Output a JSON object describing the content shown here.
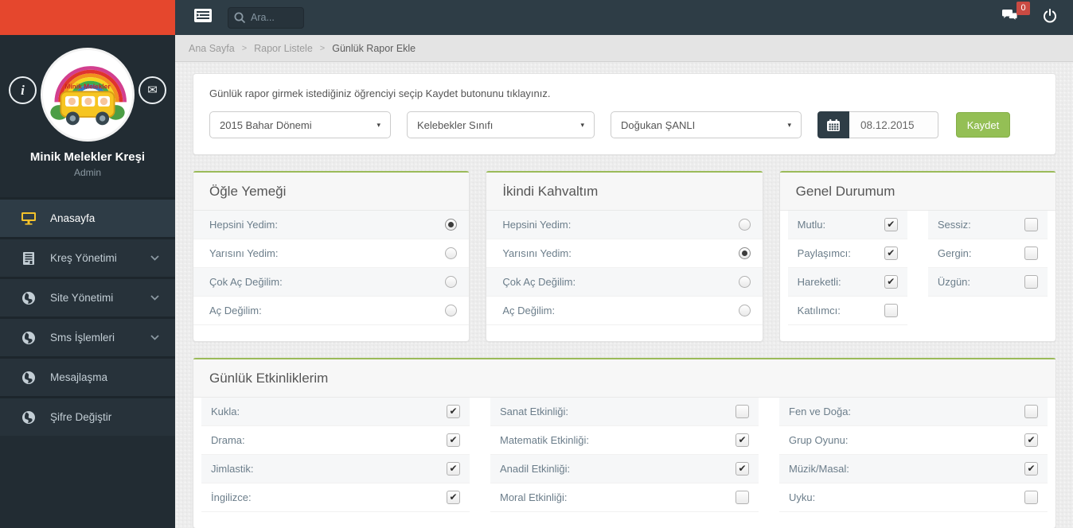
{
  "navbar": {
    "search_placeholder": "Ara...",
    "chat_badge": "0"
  },
  "sidebar": {
    "school_name": "Minik Melekler Kreşi",
    "role": "Admin",
    "avatar_text": "Minik Melekler",
    "menu": [
      {
        "label": "Anasayfa",
        "icon": "monitor-icon",
        "active": true,
        "chevron": false
      },
      {
        "label": "Kreş Yönetimi",
        "icon": "building-icon",
        "active": false,
        "chevron": true
      },
      {
        "label": "Site Yönetimi",
        "icon": "globe-icon",
        "active": false,
        "chevron": true
      },
      {
        "label": "Sms İşlemleri",
        "icon": "globe-icon",
        "active": false,
        "chevron": true
      },
      {
        "label": "Mesajlaşma",
        "icon": "globe-icon",
        "active": false,
        "chevron": false
      },
      {
        "label": "Şifre Değiştir",
        "icon": "globe-icon",
        "active": false,
        "chevron": false
      }
    ]
  },
  "breadcrumb": [
    "Ana Sayfa",
    "Rapor Listele",
    "Günlük Rapor Ekle"
  ],
  "form": {
    "instruction": "Günlük rapor girmek istediğiniz öğrenciyi seçip Kaydet butonunu tıklayınız.",
    "term_select": "2015 Bahar Dönemi",
    "class_select": "Kelebekler Sınıfı",
    "student_select": "Doğukan ŞANLI",
    "date_value": "08.12.2015",
    "save_label": "Kaydet"
  },
  "lunch": {
    "title": "Öğle Yemeği",
    "options": [
      {
        "label": "Hepsini Yedim:",
        "checked": true
      },
      {
        "label": "Yarısını Yedim:",
        "checked": false
      },
      {
        "label": "Çok Aç Değilim:",
        "checked": false
      },
      {
        "label": "Aç Değilim:",
        "checked": false
      }
    ]
  },
  "snack": {
    "title": "İkindi Kahvaltım",
    "options": [
      {
        "label": "Hepsini Yedim:",
        "checked": false
      },
      {
        "label": "Yarısını Yedim:",
        "checked": true
      },
      {
        "label": "Çok Aç Değilim:",
        "checked": false
      },
      {
        "label": "Aç Değilim:",
        "checked": false
      }
    ]
  },
  "mood": {
    "title": "Genel Durumum",
    "col1": [
      {
        "label": "Mutlu:",
        "checked": true
      },
      {
        "label": "Paylaşımcı:",
        "checked": true
      },
      {
        "label": "Hareketli:",
        "checked": true
      },
      {
        "label": "Katılımcı:",
        "checked": false
      }
    ],
    "col2": [
      {
        "label": "Sessiz:",
        "checked": false
      },
      {
        "label": "Gergin:",
        "checked": false
      },
      {
        "label": "Üzgün:",
        "checked": false
      }
    ]
  },
  "activities": {
    "title": "Günlük Etkinliklerim",
    "col1": [
      {
        "label": "Kukla:",
        "checked": true
      },
      {
        "label": "Drama:",
        "checked": true
      },
      {
        "label": "Jimlastik:",
        "checked": true
      },
      {
        "label": "İngilizce:",
        "checked": true
      }
    ],
    "col2": [
      {
        "label": "Sanat Etkinliği:",
        "checked": false
      },
      {
        "label": "Matematik Etkinliği:",
        "checked": true
      },
      {
        "label": "Anadil Etkinliği:",
        "checked": true
      },
      {
        "label": "Moral Etkinliği:",
        "checked": false
      }
    ],
    "col3": [
      {
        "label": "Fen ve Doğa:",
        "checked": false
      },
      {
        "label": "Grup Oyunu:",
        "checked": true
      },
      {
        "label": "Müzik/Masal:",
        "checked": true
      },
      {
        "label": "Uyku:",
        "checked": false
      }
    ]
  },
  "colors": {
    "brand_red": "#e5472d",
    "navbar_dark": "#2e3d46",
    "sidebar_dark": "#222c33",
    "accent_green": "#9bbb59",
    "button_green": "#94bf55",
    "badge_red": "#cb4a42",
    "active_icon_yellow": "#f3c22b"
  }
}
